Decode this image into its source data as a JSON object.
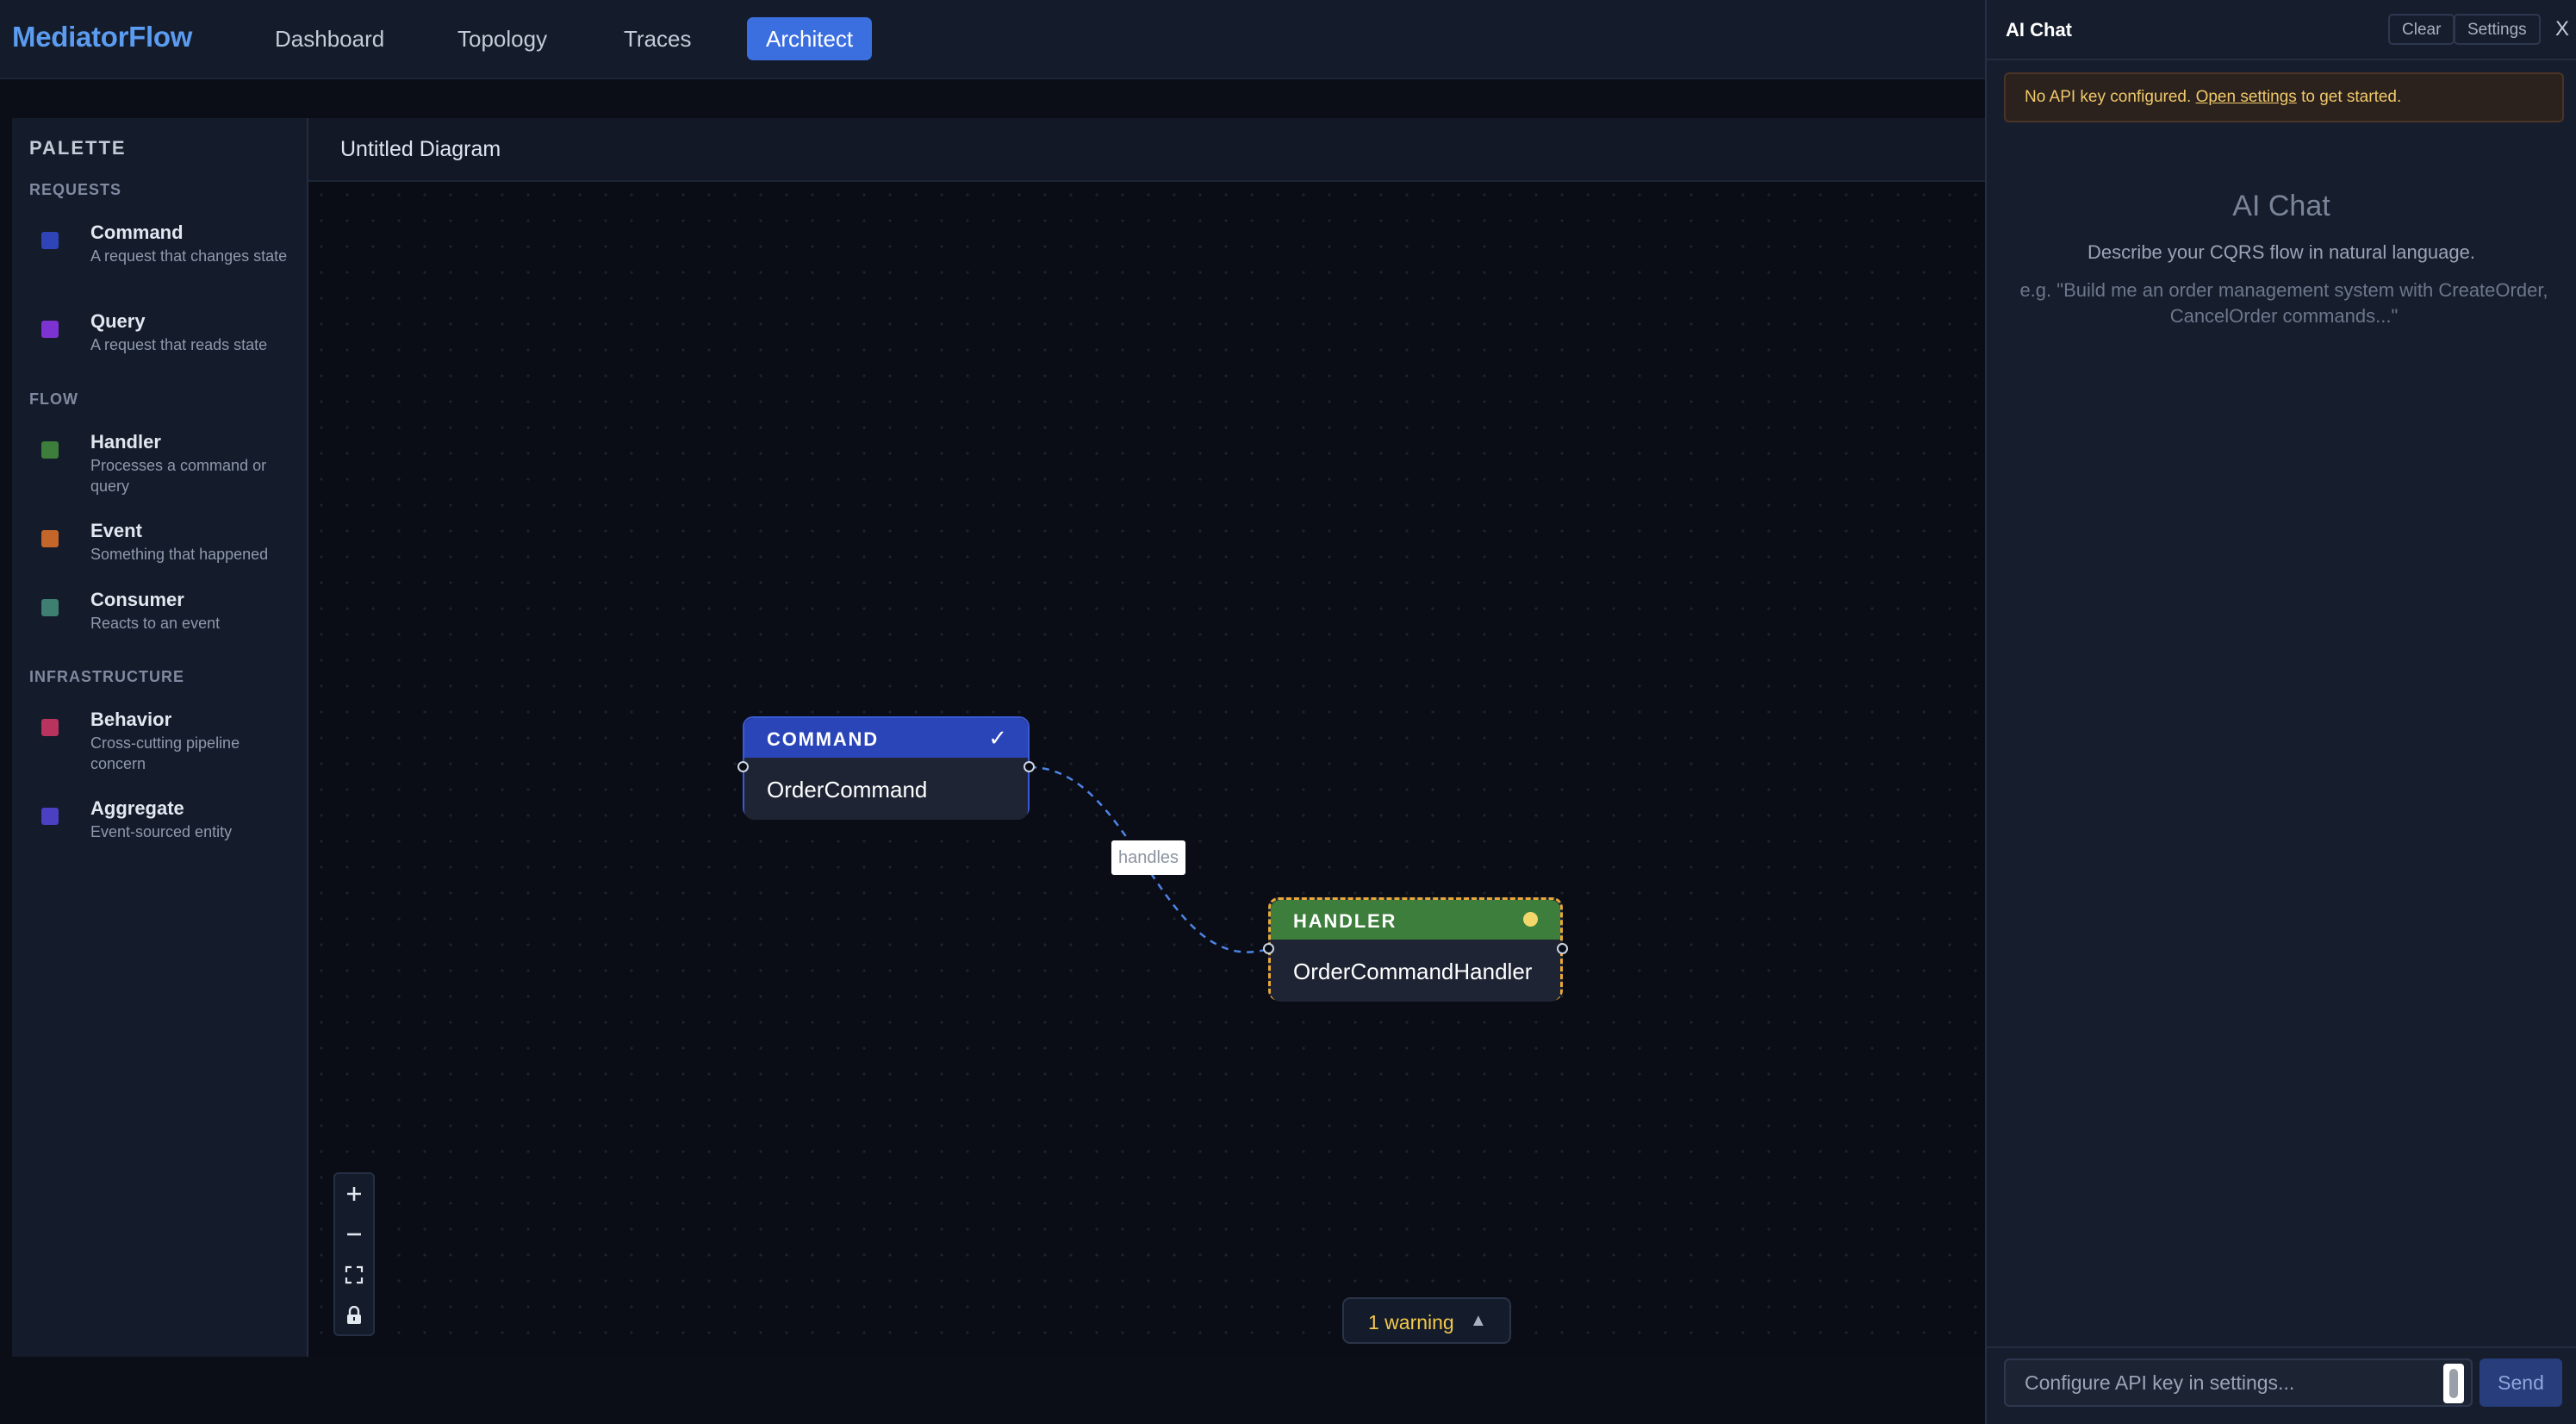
{
  "app": {
    "brand": "MediatorFlow",
    "nav": [
      {
        "label": "Dashboard"
      },
      {
        "label": "Topology"
      },
      {
        "label": "Traces"
      },
      {
        "label": "Architect",
        "active": true
      }
    ]
  },
  "palette": {
    "title": "PALETTE",
    "sections": [
      {
        "title": "REQUESTS",
        "items": [
          {
            "name": "Command",
            "desc": "A request that changes state",
            "color": "#2f44b8"
          },
          {
            "name": "Query",
            "desc": "A request that reads state",
            "color": "#7c33d1"
          }
        ]
      },
      {
        "title": "FLOW",
        "items": [
          {
            "name": "Handler",
            "desc": "Processes a command or query",
            "color": "#3d7e3c"
          },
          {
            "name": "Event",
            "desc": "Something that happened",
            "color": "#c4662a"
          },
          {
            "name": "Consumer",
            "desc": "Reacts to an event",
            "color": "#3e7f72"
          }
        ]
      },
      {
        "title": "INFRASTRUCTURE",
        "items": [
          {
            "name": "Behavior",
            "desc": "Cross-cutting pipeline concern",
            "color": "#b8345e"
          },
          {
            "name": "Aggregate",
            "desc": "Event-sourced entity",
            "color": "#4b3fc2"
          }
        ]
      }
    ]
  },
  "diagram": {
    "title": "Untitled Diagram",
    "nodes": {
      "command": {
        "type": "COMMAND",
        "label": "OrderCommand",
        "status_icon": "check-icon"
      },
      "handler": {
        "type": "HANDLER",
        "label": "OrderCommandHandler",
        "status_icon": "warning-dot-icon"
      }
    },
    "edge": {
      "label": "handles"
    },
    "controls": [
      "zoom-in-icon",
      "zoom-out-icon",
      "fit-view-icon",
      "lock-icon"
    ],
    "warnings": {
      "label": "1 warning"
    }
  },
  "chat": {
    "title": "AI Chat",
    "clear_label": "Clear",
    "settings_label": "Settings",
    "close_label": "X",
    "banner": {
      "prefix": "No API key configured. ",
      "link": "Open settings",
      "suffix": " to get started."
    },
    "empty": {
      "title": "AI Chat",
      "description": "Describe your CQRS flow in natural language.",
      "example": "e.g. \"Build me an order management system with CreateOrder, CancelOrder commands...\""
    },
    "input_placeholder": "Configure API key in settings...",
    "send_label": "Send"
  }
}
